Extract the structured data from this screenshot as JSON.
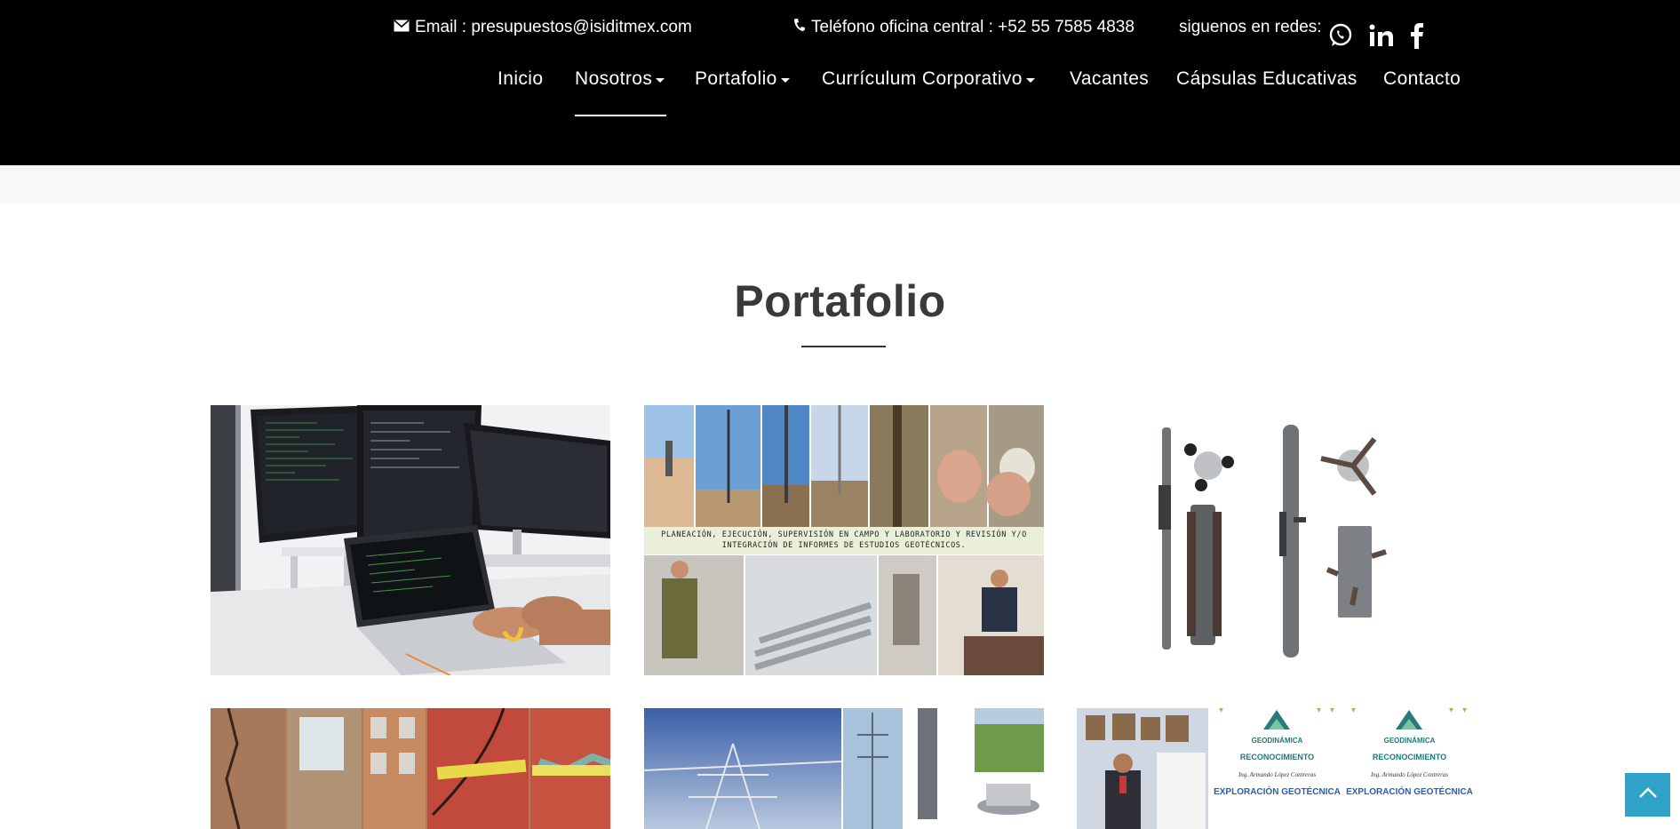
{
  "topbar": {
    "email_text": "Email : presupuestos@isiditmex.com",
    "phone_text": "Teléfono oficina central : +52 55 7585 4838",
    "social_label": "siguenos en redes:",
    "social_icons": [
      "whatsapp-icon",
      "linkedin-icon",
      "facebook-icon"
    ]
  },
  "nav": {
    "items": [
      {
        "label": "Inicio",
        "dropdown": false
      },
      {
        "label": "Nosotros",
        "dropdown": true,
        "active": true
      },
      {
        "label": "Portafolio",
        "dropdown": true
      },
      {
        "label": "Currículum Corporativo",
        "dropdown": true
      },
      {
        "label": "Vacantes",
        "dropdown": false
      },
      {
        "label": "Cápsulas Educativas",
        "dropdown": false
      },
      {
        "label": "Contacto",
        "dropdown": false
      }
    ]
  },
  "section": {
    "title": "Portafolio"
  },
  "portfolio": {
    "tile2_caption_line1": "PLANEACIÓN, EJECUCIÓN, SUPERVISIÓN EN CAMPO Y LABORATORIO Y REVISIÓN Y/O",
    "tile2_caption_line2": "INTEGRACIÓN DE INFORMES DE ESTUDIOS GEOTÉCNICOS.",
    "cert_org": "GEODINÁMICA",
    "cert_title": "RECONOCIMIENTO",
    "cert_name": "Ing. Armando López Contreras",
    "cert_subject": "EXPLORACIÓN GEOTÉCNICA"
  },
  "colors": {
    "header_bg": "#000000",
    "accent": "#2ea3c7",
    "title": "#3a3a3a"
  }
}
